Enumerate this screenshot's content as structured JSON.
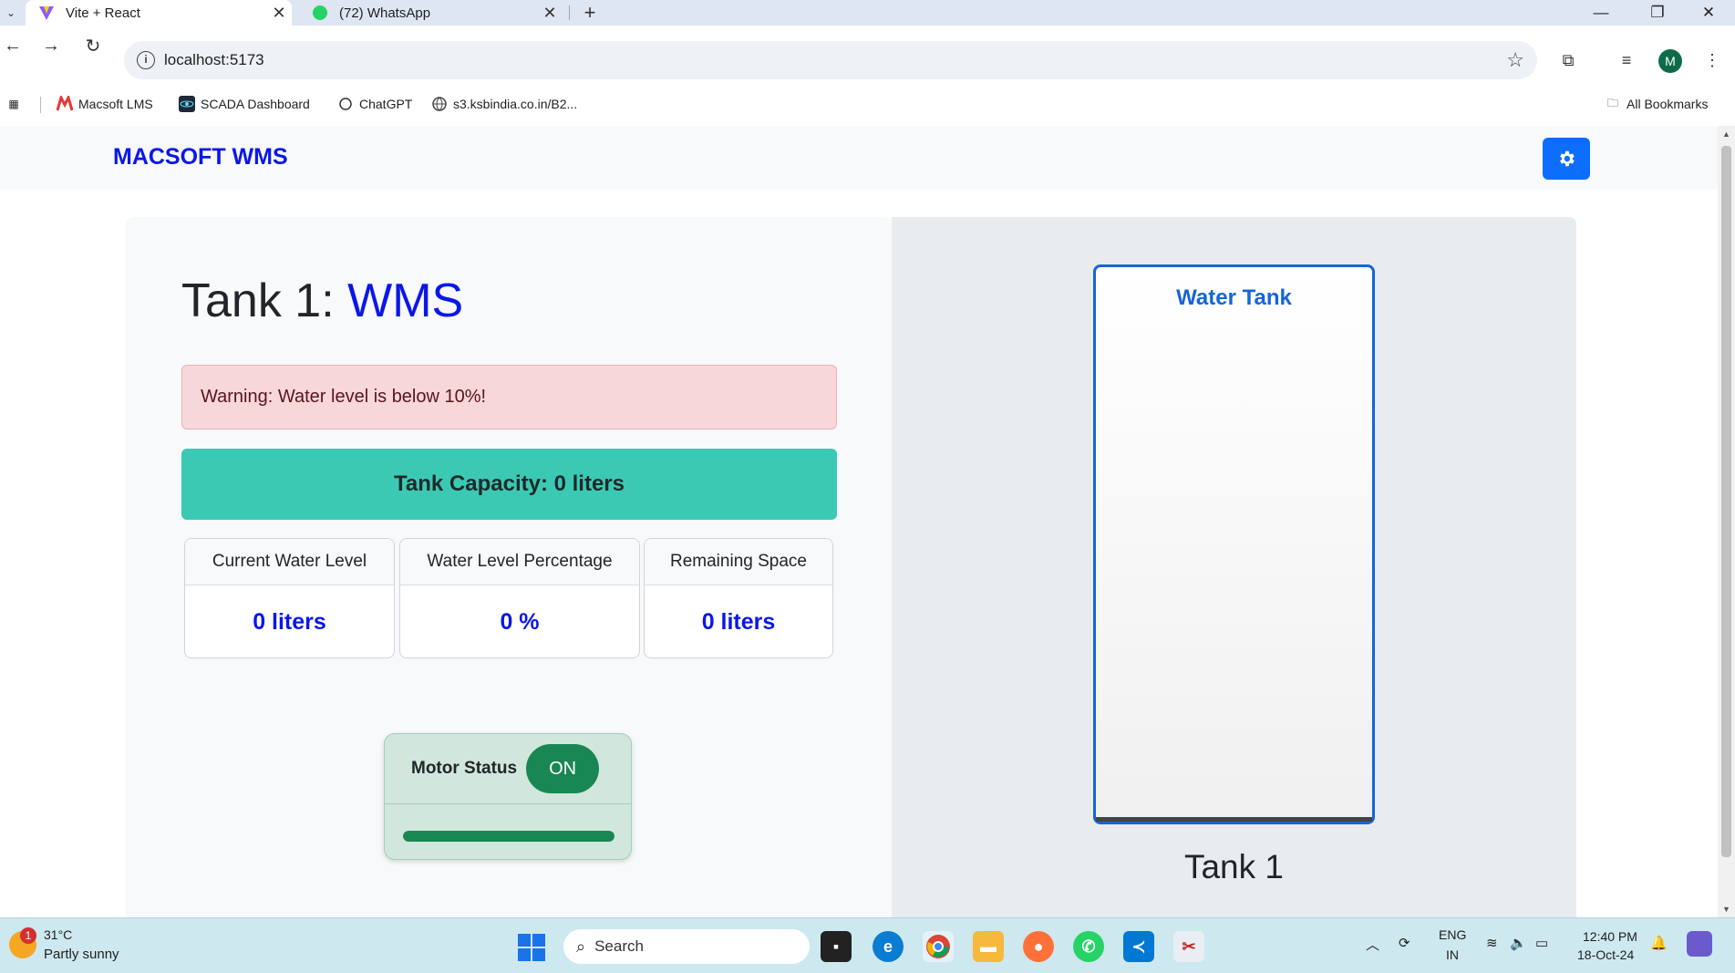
{
  "browser": {
    "tabs": [
      {
        "title": "Vite + React",
        "close": "✕"
      },
      {
        "title": "(72) WhatsApp",
        "close": "✕"
      }
    ],
    "new_tab": "+",
    "address": "localhost:5173",
    "profile_initial": "M",
    "bookmarks": [
      "Macsoft LMS",
      "SCADA Dashboard",
      "ChatGPT",
      "s3.ksbindia.co.in/B2...",
      "All Bookmarks"
    ]
  },
  "app": {
    "brand": "MACSOFT WMS",
    "tank_title_prefix": "Tank 1:",
    "tank_title_accent": "WMS",
    "warning": "Warning: Water level is below 10%!",
    "capacity": "Tank Capacity: 0 liters",
    "stats": [
      {
        "label": "Current Water Level",
        "value": "0 liters"
      },
      {
        "label": "Water Level Percentage",
        "value": "0 %"
      },
      {
        "label": "Remaining Space",
        "value": "0 liters"
      }
    ],
    "motor": {
      "label": "Motor Status",
      "state": "ON",
      "progress": 1.0
    },
    "tank_visual": {
      "label": "Water Tank",
      "fill_percent": 0,
      "name": "Tank 1"
    },
    "colors": {
      "brand": "#0a17e8",
      "primary": "#0d6efd",
      "success": "#198754",
      "teal": "#3cc9b4"
    }
  },
  "taskbar": {
    "weather_badge": "1",
    "temperature": "31°C",
    "weather": "Partly sunny",
    "search": "Search",
    "lang_top": "ENG",
    "lang_bottom": "IN",
    "time": "12:40 PM",
    "date": "18-Oct-24"
  }
}
